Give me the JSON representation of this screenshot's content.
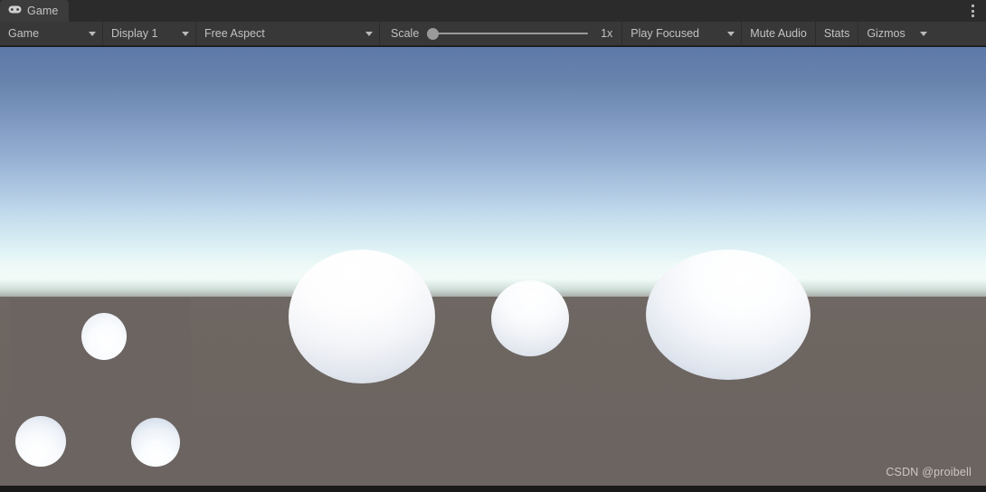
{
  "window": {
    "tab": {
      "label": "Game",
      "icon": "gamepad-icon"
    },
    "overflow_menu_icon": "kebab-menu-icon"
  },
  "toolbar": {
    "view_mode": {
      "label": "Game",
      "icon": "chevron-down-icon"
    },
    "display": {
      "label": "Display 1",
      "icon": "chevron-down-icon"
    },
    "aspect": {
      "label": "Free Aspect",
      "icon": "chevron-down-icon"
    },
    "scale": {
      "label": "Scale",
      "value_label": "1x",
      "value": 1,
      "min": 1,
      "max": 5,
      "handle_position_percent": 0
    },
    "play_mode": {
      "label": "Play Focused",
      "icon": "chevron-down-icon"
    },
    "mute_audio": {
      "label": "Mute Audio"
    },
    "stats": {
      "label": "Stats"
    },
    "gizmos": {
      "label": "Gizmos",
      "icon": "chevron-down-icon"
    }
  },
  "viewport": {
    "scene": {
      "sky_top_color": "#5d79a8",
      "sky_horizon_color": "#f2fbf8",
      "ground_color": "#6b6460",
      "objects": [
        {
          "name": "sphere-large-left"
        },
        {
          "name": "sphere-small-center"
        },
        {
          "name": "sphere-large-right"
        }
      ]
    },
    "inset_camera": {
      "name": "picture-in-picture-camera-view",
      "objects": [
        {
          "name": "inset-sphere-top"
        },
        {
          "name": "inset-sphere-bottom-left"
        },
        {
          "name": "inset-sphere-bottom-right"
        }
      ]
    },
    "watermark": "CSDN @proibell"
  }
}
